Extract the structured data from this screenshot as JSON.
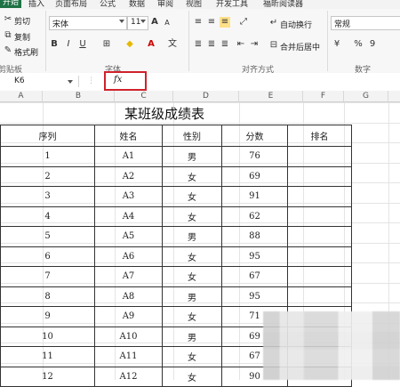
{
  "ribbon": {
    "tabs": [
      "开始",
      "插入",
      "页面布局",
      "公式",
      "数据",
      "审阅",
      "视图",
      "开发工具",
      "福昕阅读器"
    ],
    "clipboard": {
      "cut": "剪切",
      "copy": "复制",
      "format_painter": "格式刷",
      "group": "剪贴板"
    },
    "font": {
      "name": "宋体",
      "size": "11",
      "group": "字体",
      "bold": "B",
      "italic": "I",
      "underline": "U"
    },
    "alignment": {
      "wrap": "自动换行",
      "merge": "合并后居中",
      "group": "对齐方式"
    },
    "number": {
      "format": "常规",
      "percent": "%",
      "comma": "9",
      "group": "数字"
    }
  },
  "formula_bar": {
    "cell_ref": "K6",
    "fx": "fx",
    "value": ""
  },
  "columns": [
    "A",
    "B",
    "C",
    "D",
    "E",
    "F",
    "G"
  ],
  "sheet": {
    "title": "某班级成绩表",
    "headers": [
      "序列",
      "姓名",
      "性别",
      "分数",
      "排名"
    ],
    "rows": [
      [
        "1",
        "A1",
        "男",
        "76",
        ""
      ],
      [
        "2",
        "A2",
        "女",
        "69",
        ""
      ],
      [
        "3",
        "A3",
        "女",
        "91",
        ""
      ],
      [
        "4",
        "A4",
        "女",
        "62",
        ""
      ],
      [
        "5",
        "A5",
        "男",
        "88",
        ""
      ],
      [
        "6",
        "A6",
        "女",
        "95",
        ""
      ],
      [
        "7",
        "A7",
        "女",
        "67",
        ""
      ],
      [
        "8",
        "A8",
        "男",
        "95",
        ""
      ],
      [
        "9",
        "A9",
        "女",
        "71",
        ""
      ],
      [
        "10",
        "A10",
        "男",
        "69",
        ""
      ],
      [
        "11",
        "A11",
        "女",
        "67",
        ""
      ],
      [
        "12",
        "A12",
        "女",
        "90",
        ""
      ]
    ]
  },
  "colors": {
    "active_tab": "#1f7244",
    "highlight": "#d0212b"
  }
}
